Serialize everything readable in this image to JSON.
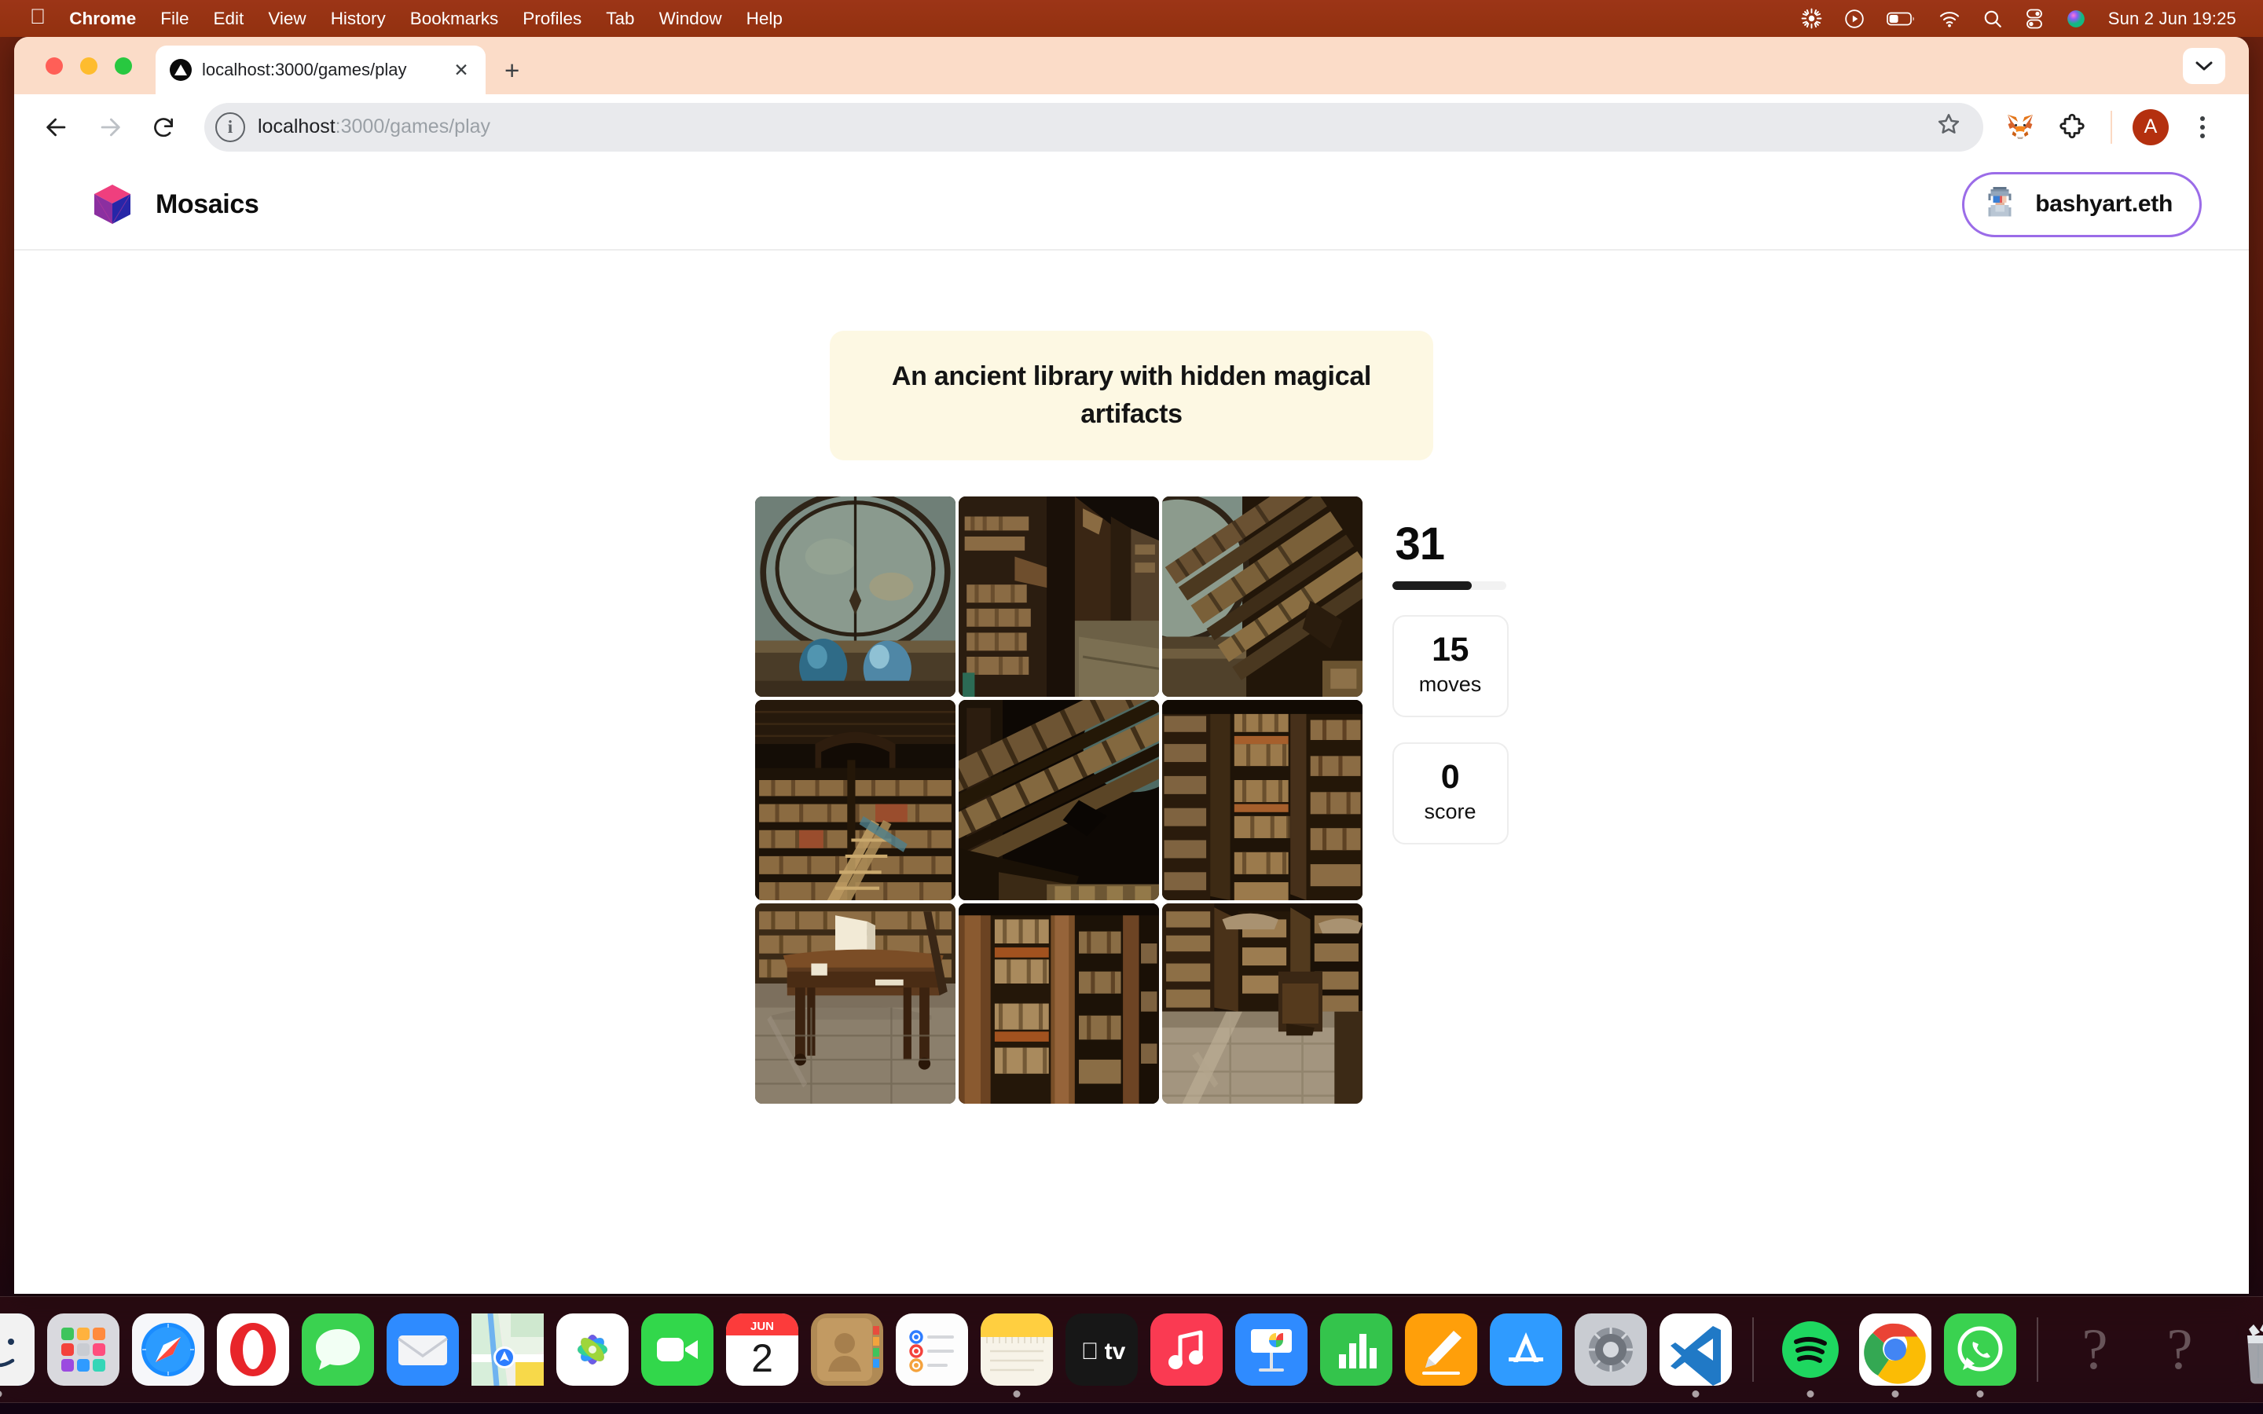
{
  "menubar": {
    "apple_icon": "apple-logo-icon",
    "items": [
      {
        "label": "Chrome",
        "bold": true
      },
      {
        "label": "File",
        "bold": false
      },
      {
        "label": "Edit",
        "bold": false
      },
      {
        "label": "View",
        "bold": false
      },
      {
        "label": "History",
        "bold": false
      },
      {
        "label": "Bookmarks",
        "bold": false
      },
      {
        "label": "Profiles",
        "bold": false
      },
      {
        "label": "Tab",
        "bold": false
      },
      {
        "label": "Window",
        "bold": false
      },
      {
        "label": "Help",
        "bold": false
      }
    ],
    "status_icons": [
      "sunburst-icon",
      "play-circle-icon",
      "battery-icon",
      "wifi-icon",
      "search-icon",
      "control-center-icon",
      "siri-icon"
    ],
    "clock": "Sun 2 Jun  19:25"
  },
  "browser": {
    "traffic_lights": [
      "close",
      "minimize",
      "zoom"
    ],
    "tab": {
      "favicon": "vercel-triangle-icon",
      "title": "localhost:3000/games/play",
      "close_label": "✕"
    },
    "new_tab_label": "+",
    "tabstrip_expand_icon": "chevron-down-icon",
    "toolbar": {
      "back_icon": "arrow-left-icon",
      "forward_icon": "arrow-right-icon",
      "reload_icon": "reload-icon",
      "site_info_icon": "info-circle-icon",
      "url_host": "localhost",
      "url_path": ":3000/games/play",
      "bookmark_icon": "star-icon",
      "metamask_icon": "metamask-fox-icon",
      "extensions_icon": "puzzle-piece-icon",
      "profile_initial": "A",
      "menu_icon": "kebab-menu-icon"
    }
  },
  "app": {
    "logo_icon": "mosaics-cube-icon",
    "brand": "Mosaics",
    "wallet": {
      "avatar_icon": "pixel-avatar-icon",
      "name": "bashyart.eth",
      "border_color": "#9b6ce8"
    },
    "prompt": "An ancient library with hidden magical artifacts",
    "prompt_bg": "#fdf8e3",
    "stats": {
      "timer": "31",
      "timer_progress_percent": 70,
      "moves_value": "15",
      "moves_label": "moves",
      "score_value": "0",
      "score_label": "score"
    },
    "grid": {
      "rows": 3,
      "cols": 3,
      "tiles": [
        {
          "name": "tile-0",
          "alt": "domed ceiling with two blue orbs"
        },
        {
          "name": "tile-1",
          "alt": "bookshelf aisle with wooden cabinets"
        },
        {
          "name": "tile-2",
          "alt": "carved cornice and dome edge"
        },
        {
          "name": "tile-3",
          "alt": "tall bookcase with ladder"
        },
        {
          "name": "tile-4",
          "alt": "ornate beam running diagonally"
        },
        {
          "name": "tile-5",
          "alt": "stacked shelves of books"
        },
        {
          "name": "tile-6",
          "alt": "reading table on stone floor"
        },
        {
          "name": "tile-7",
          "alt": "wooden columns and book rows"
        },
        {
          "name": "tile-8",
          "alt": "sunlit library corridor"
        }
      ]
    }
  },
  "dock": {
    "apps": [
      {
        "name": "finder",
        "running": true
      },
      {
        "name": "launchpad",
        "running": false
      },
      {
        "name": "safari",
        "running": false
      },
      {
        "name": "opera",
        "running": false
      },
      {
        "name": "messages",
        "running": false
      },
      {
        "name": "mail",
        "running": false
      },
      {
        "name": "maps",
        "running": false
      },
      {
        "name": "photos",
        "running": false
      },
      {
        "name": "facetime",
        "running": false
      },
      {
        "name": "calendar",
        "running": false,
        "month": "JUN",
        "day": "2"
      },
      {
        "name": "contacts",
        "running": false
      },
      {
        "name": "reminders",
        "running": false
      },
      {
        "name": "notes",
        "running": true
      },
      {
        "name": "appletv",
        "running": false
      },
      {
        "name": "music",
        "running": false
      },
      {
        "name": "keynote",
        "running": false
      },
      {
        "name": "numbers",
        "running": false
      },
      {
        "name": "pages",
        "running": false
      },
      {
        "name": "appstore",
        "running": false
      },
      {
        "name": "system-settings",
        "running": false
      },
      {
        "name": "vscode",
        "running": true
      },
      {
        "name": "spotify",
        "running": true
      },
      {
        "name": "chrome",
        "running": true
      },
      {
        "name": "whatsapp",
        "running": true
      }
    ],
    "placeholders": [
      "?",
      "?"
    ],
    "trash": "trash-icon"
  }
}
